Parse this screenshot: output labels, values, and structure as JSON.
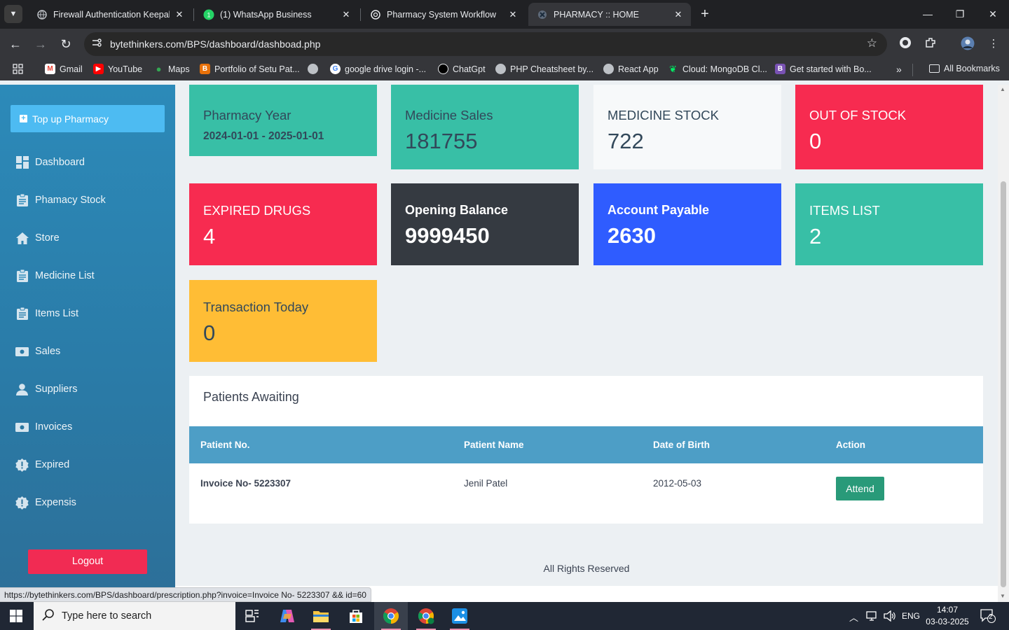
{
  "browser": {
    "tabs": [
      {
        "title": "Firewall Authentication Keepalive",
        "active": false
      },
      {
        "title": "(1) WhatsApp Business",
        "active": false
      },
      {
        "title": "Pharmacy System Workflow",
        "active": false
      },
      {
        "title": "PHARMACY :: HOME",
        "active": true
      }
    ],
    "url": "bytethinkers.com/BPS/dashboard/dashboad.php",
    "bookmarks": [
      {
        "label": "Gmail",
        "color": "#ea4335",
        "icon": "gmail-icon"
      },
      {
        "label": "YouTube",
        "color": "#ff0000",
        "icon": "youtube-icon"
      },
      {
        "label": "Maps",
        "color": "#34a853",
        "icon": "maps-icon"
      },
      {
        "label": "Portfolio of Setu Pat...",
        "color": "#e8710a",
        "icon": "portfolio-icon"
      },
      {
        "label": "",
        "color": "#9aa0a6",
        "icon": "globe-icon"
      },
      {
        "label": "google drive login -...",
        "color": "#4285f4",
        "icon": "google-icon"
      },
      {
        "label": "ChatGpt",
        "color": "#202124",
        "icon": "chatgpt-icon"
      },
      {
        "label": "PHP Cheatsheet by...",
        "color": "#9aa0a6",
        "icon": "globe-icon"
      },
      {
        "label": "React App",
        "color": "#9aa0a6",
        "icon": "globe-icon"
      },
      {
        "label": "Cloud: MongoDB Cl...",
        "color": "#00ed64",
        "icon": "mongodb-icon"
      },
      {
        "label": "Get started with Bo...",
        "color": "#7952b3",
        "icon": "bootstrap-icon"
      }
    ],
    "all_bookmarks": "All Bookmarks",
    "status_url": "https://bytethinkers.com/BPS/dashboard/prescription.php?invoice=Invoice No-  5223307 &&  id=60"
  },
  "sidebar": {
    "topup_label": "Top up Pharmacy",
    "items": [
      {
        "label": "Dashboard",
        "icon": "dashboard-icon"
      },
      {
        "label": "Phamacy Stock",
        "icon": "clipboard-icon"
      },
      {
        "label": "Store",
        "icon": "home-icon"
      },
      {
        "label": "Medicine List",
        "icon": "clipboard-icon"
      },
      {
        "label": "Items List",
        "icon": "clipboard-icon"
      },
      {
        "label": "Sales",
        "icon": "money-icon"
      },
      {
        "label": "Suppliers",
        "icon": "user-icon"
      },
      {
        "label": "Invoices",
        "icon": "money-icon"
      },
      {
        "label": "Expired",
        "icon": "alert-badge-icon"
      },
      {
        "label": "Expensis",
        "icon": "alert-badge-icon"
      }
    ],
    "logout_label": "Logout"
  },
  "cards": {
    "pharmacy_year": {
      "label": "Pharmacy Year",
      "value": "2024-01-01 - 2025-01-01",
      "color": "#38bfa6"
    },
    "medicine_sales": {
      "label": "Medicine Sales",
      "value": "181755",
      "color": "#38bfa6"
    },
    "medicine_stock": {
      "label": "MEDICINE STOCK",
      "value": "722",
      "color": "#f7f9fa"
    },
    "out_of_stock": {
      "label": "OUT OF STOCK",
      "value": "0",
      "color": "#f72b50"
    },
    "expired_drugs": {
      "label": "EXPIRED DRUGS",
      "value": "4",
      "color": "#f72b50"
    },
    "opening_balance": {
      "label": "Opening Balance",
      "value": "9999450",
      "color": "#353a41"
    },
    "account_payable": {
      "label": "Account Payable",
      "value": "2630",
      "color": "#2f5cff"
    },
    "items_list": {
      "label": "ITEMS LIST",
      "value": "2",
      "color": "#38bfa6"
    },
    "transaction_today": {
      "label": "Transaction Today",
      "value": "0",
      "color": "#ffbd35"
    }
  },
  "patients": {
    "title": "Patients Awaiting",
    "columns": [
      "Patient No.",
      "Patient Name",
      "Date of Birth",
      "Action"
    ],
    "rows": [
      {
        "patient_no": "Invoice No- 5223307",
        "name": "Jenil Patel",
        "dob": "2012-05-03",
        "action": "Attend"
      }
    ]
  },
  "footer": "All Rights Reserved",
  "taskbar": {
    "search_placeholder": "Type here to search",
    "language": "ENG",
    "time": "14:07",
    "date": "03-03-2025",
    "notifications": "2"
  }
}
